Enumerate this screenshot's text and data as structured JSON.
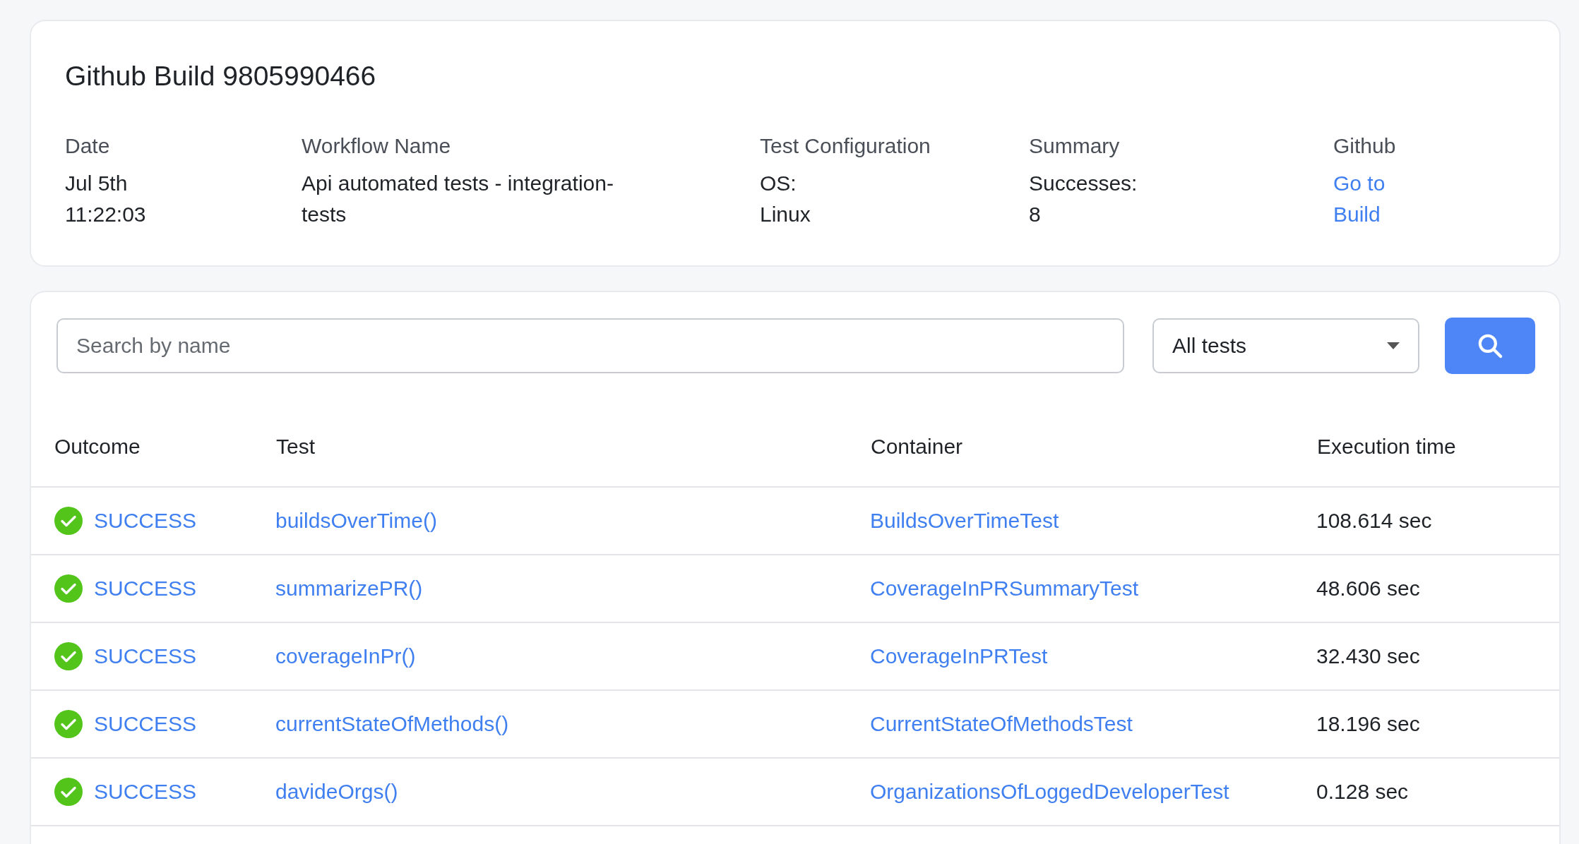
{
  "build": {
    "title": "Github Build 9805990466",
    "fields": [
      {
        "label": "Date",
        "value": "Jul 5th 11:22:03",
        "kind": "text"
      },
      {
        "label": "Workflow Name",
        "value": "Api automated tests - integration-tests",
        "kind": "text"
      },
      {
        "label": "Test Configuration",
        "value": "OS: Linux",
        "kind": "text"
      },
      {
        "label": "Summary",
        "value": "Successes: 8",
        "kind": "text"
      },
      {
        "label": "Github",
        "value": "Go to Build",
        "kind": "link"
      }
    ]
  },
  "filters": {
    "search": {
      "placeholder": "Search by name"
    },
    "dropdown": {
      "value": "All tests"
    }
  },
  "table": {
    "columns": [
      "Outcome",
      "Test",
      "Container",
      "Execution time"
    ],
    "rows": [
      {
        "kind": "success",
        "outcome": "SUCCESS",
        "test": "buildsOverTime()",
        "container": "BuildsOverTimeTest",
        "time": "108.614 sec"
      },
      {
        "kind": "success",
        "outcome": "SUCCESS",
        "test": "summarizePR()",
        "container": "CoverageInPRSummaryTest",
        "time": "48.606 sec"
      },
      {
        "kind": "success",
        "outcome": "SUCCESS",
        "test": "coverageInPr()",
        "container": "CoverageInPRTest",
        "time": "32.430 sec"
      },
      {
        "kind": "success",
        "outcome": "SUCCESS",
        "test": "currentStateOfMethods()",
        "container": "CurrentStateOfMethodsTest",
        "time": "18.196 sec"
      },
      {
        "kind": "success",
        "outcome": "SUCCESS",
        "test": "davideOrgs()",
        "container": "OrganizationsOfLoggedDeveloperTest",
        "time": "0.128 sec"
      }
    ]
  }
}
